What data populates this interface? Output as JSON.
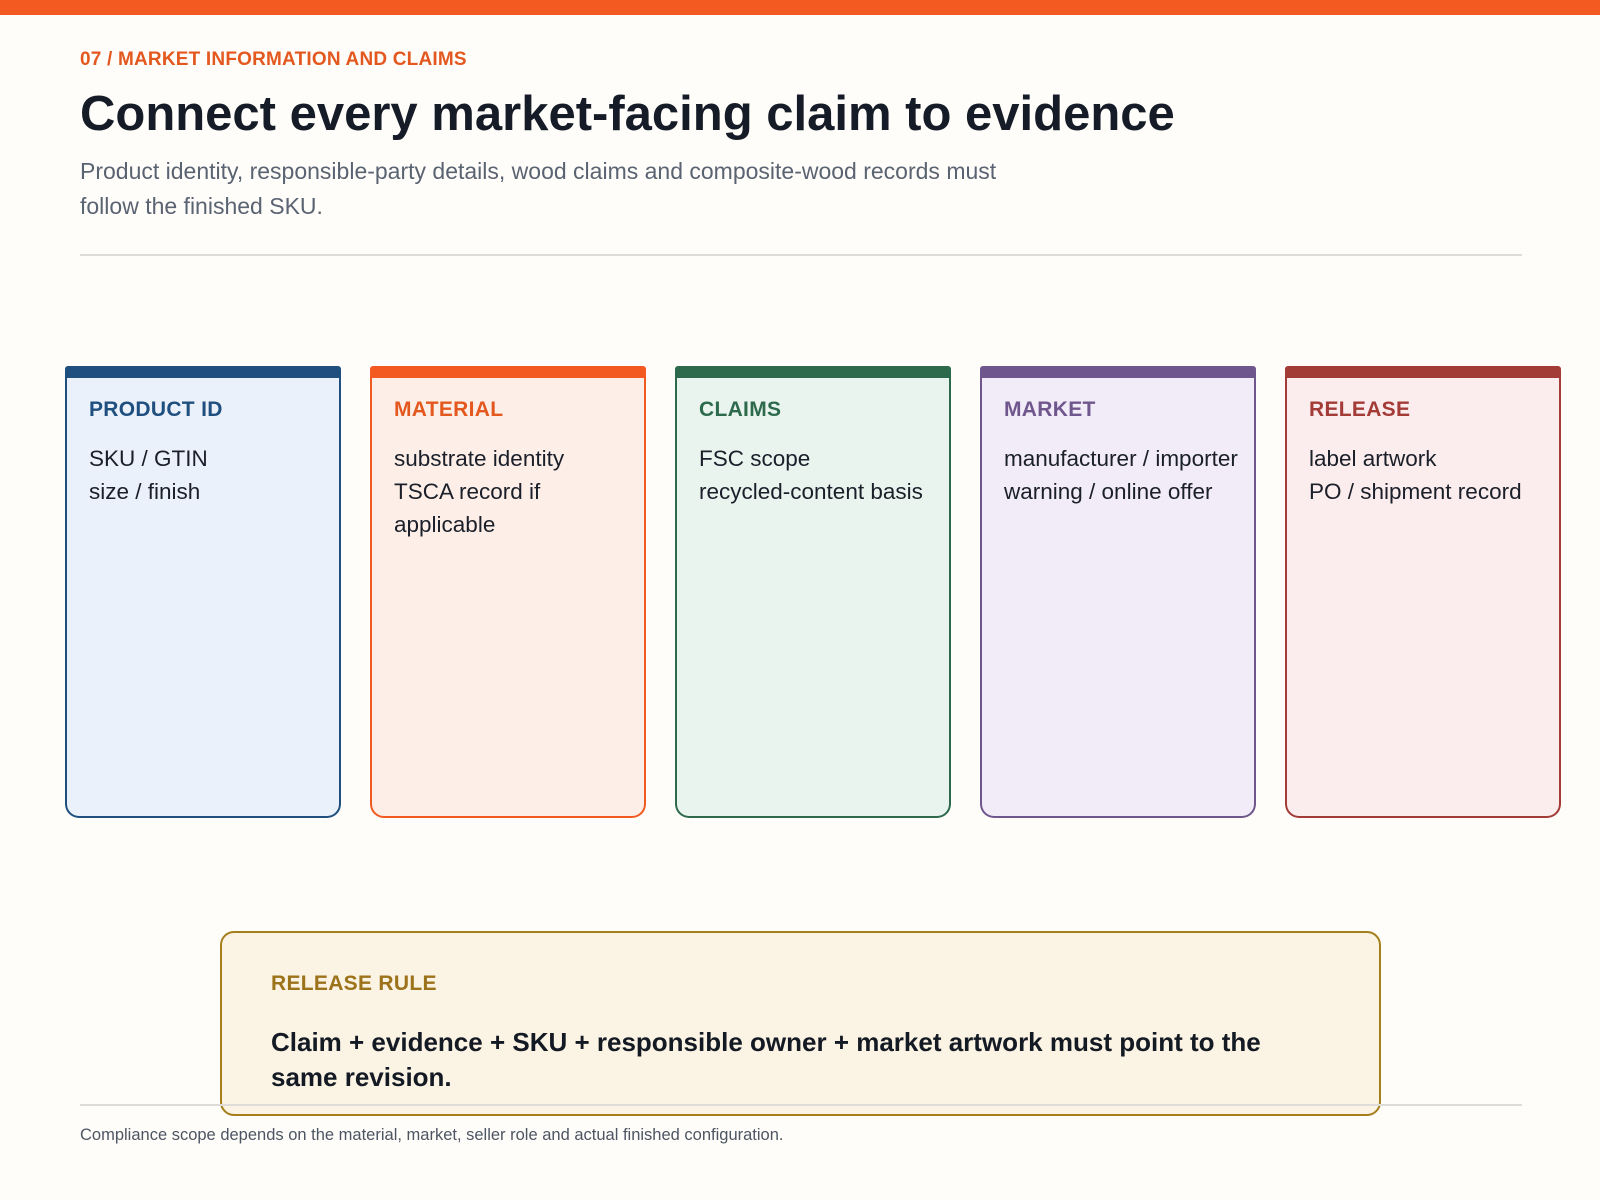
{
  "header": {
    "eyebrow": "07 / MARKET INFORMATION AND CLAIMS",
    "title": "Connect every market-facing claim to evidence",
    "subtitle": "Product identity, responsible-party details, wood claims and composite-wood records must follow the finished SKU."
  },
  "cards": [
    {
      "title": "PRODUCT ID",
      "lines": [
        "SKU / GTIN",
        "size / finish"
      ],
      "accent_color": "#1f4f7e",
      "fill_color": "#eaf1fa",
      "title_color": "#1f4f7e"
    },
    {
      "title": "MATERIAL",
      "lines": [
        "substrate identity",
        "TSCA record if applicable"
      ],
      "accent_color": "#f25a22",
      "fill_color": "#fdefe8",
      "title_color": "#e3581f"
    },
    {
      "title": "CLAIMS",
      "lines": [
        "FSC scope",
        "recycled-content basis"
      ],
      "accent_color": "#2d6a4c",
      "fill_color": "#eaf4ef",
      "title_color": "#2d6a4c"
    },
    {
      "title": "MARKET",
      "lines": [
        "manufacturer / importer",
        "warning / online offer"
      ],
      "accent_color": "#6f568d",
      "fill_color": "#f2ecf8",
      "title_color": "#6f568d"
    },
    {
      "title": "RELEASE",
      "lines": [
        "label artwork",
        "PO / shipment record"
      ],
      "accent_color": "#a33b37",
      "fill_color": "#fbeced",
      "title_color": "#a33b37"
    }
  ],
  "release_rule": {
    "label": "RELEASE RULE",
    "text": "Claim + evidence + SKU + responsible owner + market artwork must point to the same revision."
  },
  "footer": {
    "note": "Compliance scope depends on the material, market, seller role and actual finished configuration."
  },
  "colors": {
    "brand_accent": "#f25a22",
    "rule_accent": "#a57f1c"
  }
}
